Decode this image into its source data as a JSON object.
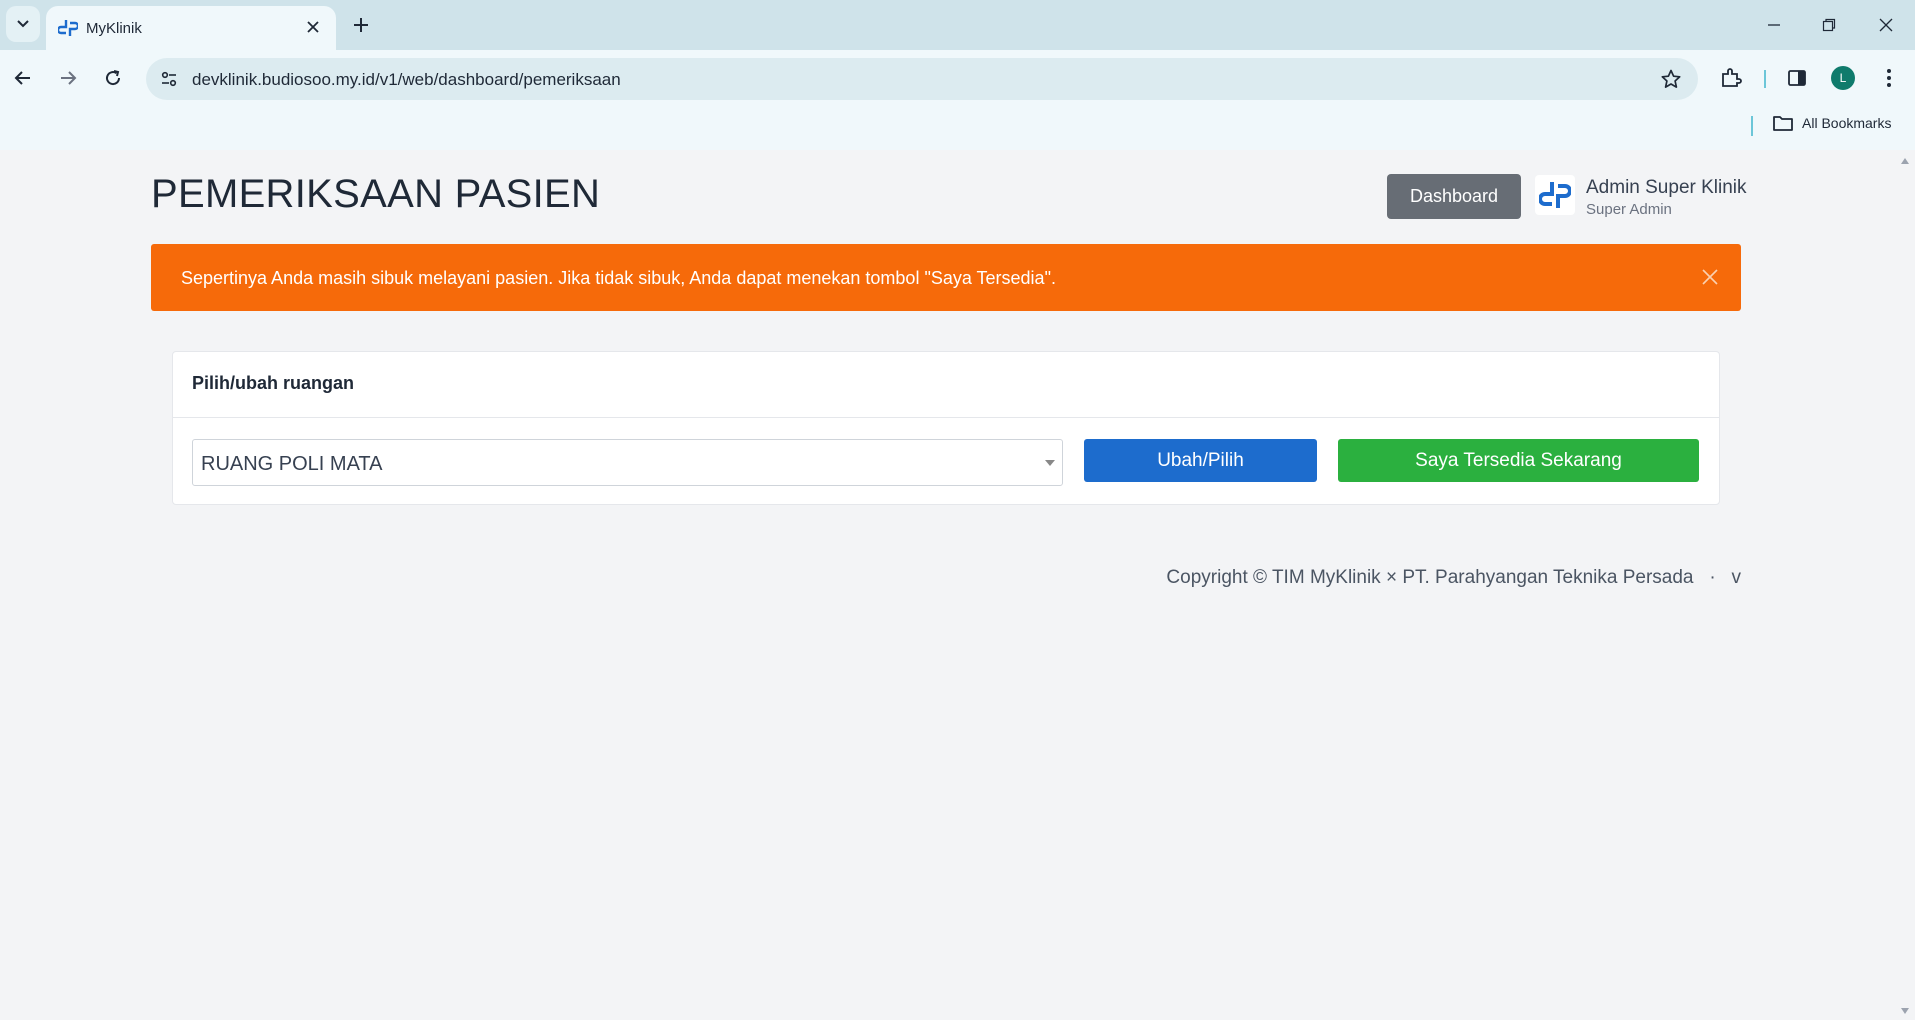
{
  "browser": {
    "tab_title": "MyKlinik",
    "url": "devklinik.budiosoo.my.id/v1/web/dashboard/pemeriksaan",
    "profile_initial": "L",
    "bookmarks_label": "All Bookmarks"
  },
  "header": {
    "title": "PEMERIKSAAN PASIEN",
    "dashboard_label": "Dashboard",
    "user_name": "Admin Super Klinik",
    "user_role": "Super Admin"
  },
  "alert": {
    "message": "Sepertinya Anda masih sibuk melayani pasien. Jika tidak sibuk, Anda dapat menekan tombol \"Saya Tersedia\"."
  },
  "room_card": {
    "title": "Pilih/ubah ruangan",
    "selected_room": "RUANG POLI MATA",
    "change_button": "Ubah/Pilih",
    "available_button": "Saya Tersedia Sekarang"
  },
  "footer": {
    "copyright": "Copyright © TIM MyKlinik × PT. Parahyangan Teknika Persada   ·   v"
  },
  "colors": {
    "alert": "#f66a0a",
    "primary": "#1d6ccd",
    "success": "#2bb03f",
    "secondary": "#676d75"
  }
}
